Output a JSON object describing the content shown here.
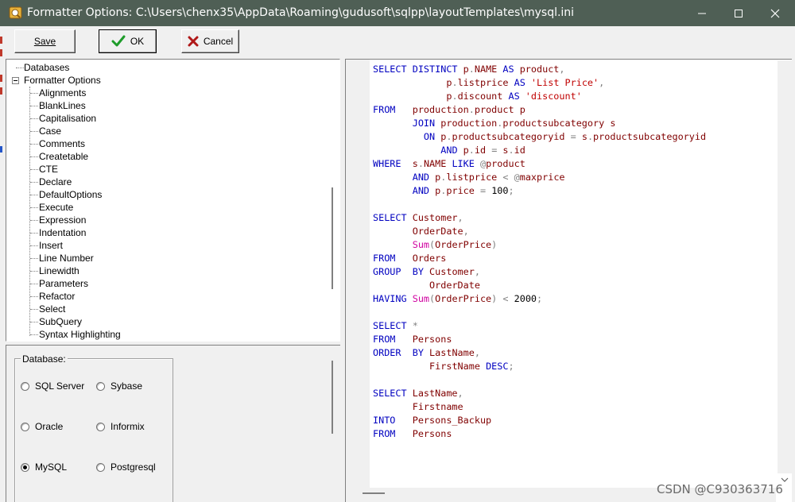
{
  "window": {
    "title": "Formatter Options: C:\\Users\\chenx35\\AppData\\Roaming\\gudusoft\\sqlpp\\layoutTemplates\\mysql.ini",
    "title_bar_color": "#4f5f55"
  },
  "toolbar": {
    "save_label": "Save",
    "ok_label": "OK",
    "cancel_label": "Cancel",
    "ok_icon": "green-check-icon",
    "cancel_icon": "red-x-icon"
  },
  "tree": {
    "root_items": [
      "Databases",
      "Formatter Options"
    ],
    "children": [
      "Alignments",
      "BlankLines",
      "Capitalisation",
      "Case",
      "Comments",
      "Createtable",
      "CTE",
      "Declare",
      "DefaultOptions",
      "Execute",
      "Expression",
      "Indentation",
      "Insert",
      "Line Number",
      "Linewidth",
      "Parameters",
      "Refactor",
      "Select",
      "SubQuery",
      "Syntax Highlighting"
    ]
  },
  "database_group": {
    "legend": "Database:",
    "options": [
      {
        "label": "SQL Server",
        "checked": false
      },
      {
        "label": "Sybase",
        "checked": false
      },
      {
        "label": "Oracle",
        "checked": false
      },
      {
        "label": "Informix",
        "checked": false
      },
      {
        "label": "MySQL",
        "checked": true
      },
      {
        "label": "Postgresql",
        "checked": false
      }
    ]
  },
  "colors": {
    "keyword": "#0000c0",
    "identifier": "#800000",
    "string": "#c00000",
    "function": "#d000a0"
  },
  "code_lines": [
    [
      [
        "kw",
        "SELECT "
      ],
      [
        "kw",
        "DISTINCT "
      ],
      [
        "id",
        "p"
      ],
      [
        "op",
        "."
      ],
      [
        "id",
        "NAME "
      ],
      [
        "kw",
        "AS "
      ],
      [
        "id",
        "product"
      ],
      [
        "op",
        ","
      ]
    ],
    [
      [
        "",
        "             "
      ],
      [
        "id",
        "p"
      ],
      [
        "op",
        "."
      ],
      [
        "id",
        "listprice "
      ],
      [
        "kw",
        "AS "
      ],
      [
        "str",
        "'List Price'"
      ],
      [
        "op",
        ","
      ]
    ],
    [
      [
        "",
        "             "
      ],
      [
        "id",
        "p"
      ],
      [
        "op",
        "."
      ],
      [
        "id",
        "discount "
      ],
      [
        "kw",
        "AS "
      ],
      [
        "str",
        "'discount'"
      ]
    ],
    [
      [
        "kw",
        "FROM   "
      ],
      [
        "id",
        "production"
      ],
      [
        "op",
        "."
      ],
      [
        "id",
        "product "
      ],
      [
        "id",
        "p"
      ]
    ],
    [
      [
        "",
        "       "
      ],
      [
        "kw",
        "JOIN "
      ],
      [
        "id",
        "production"
      ],
      [
        "op",
        "."
      ],
      [
        "id",
        "productsubcategory "
      ],
      [
        "id",
        "s"
      ]
    ],
    [
      [
        "",
        "         "
      ],
      [
        "kw",
        "ON "
      ],
      [
        "id",
        "p"
      ],
      [
        "op",
        "."
      ],
      [
        "id",
        "productsubcategoryid "
      ],
      [
        "op",
        "= "
      ],
      [
        "id",
        "s"
      ],
      [
        "op",
        "."
      ],
      [
        "id",
        "productsubcategoryid"
      ]
    ],
    [
      [
        "",
        "            "
      ],
      [
        "kw",
        "AND "
      ],
      [
        "id",
        "p"
      ],
      [
        "op",
        "."
      ],
      [
        "id",
        "id "
      ],
      [
        "op",
        "= "
      ],
      [
        "id",
        "s"
      ],
      [
        "op",
        "."
      ],
      [
        "id",
        "id"
      ]
    ],
    [
      [
        "kw",
        "WHERE  "
      ],
      [
        "id",
        "s"
      ],
      [
        "op",
        "."
      ],
      [
        "id",
        "NAME "
      ],
      [
        "kw",
        "LIKE "
      ],
      [
        "op",
        "@"
      ],
      [
        "var",
        "product"
      ]
    ],
    [
      [
        "",
        "       "
      ],
      [
        "kw",
        "AND "
      ],
      [
        "id",
        "p"
      ],
      [
        "op",
        "."
      ],
      [
        "id",
        "listprice "
      ],
      [
        "op",
        "< "
      ],
      [
        "op",
        "@"
      ],
      [
        "var",
        "maxprice"
      ]
    ],
    [
      [
        "",
        "       "
      ],
      [
        "kw",
        "AND "
      ],
      [
        "id",
        "p"
      ],
      [
        "op",
        "."
      ],
      [
        "id",
        "price "
      ],
      [
        "op",
        "= "
      ],
      [
        "num",
        "100"
      ],
      [
        "op",
        ";"
      ]
    ],
    [
      [
        "",
        ""
      ]
    ],
    [
      [
        "kw",
        "SELECT "
      ],
      [
        "id",
        "Customer"
      ],
      [
        "op",
        ","
      ]
    ],
    [
      [
        "",
        "       "
      ],
      [
        "id",
        "OrderDate"
      ],
      [
        "op",
        ","
      ]
    ],
    [
      [
        "",
        "       "
      ],
      [
        "fn",
        "Sum"
      ],
      [
        "op",
        "("
      ],
      [
        "id",
        "OrderPrice"
      ],
      [
        "op",
        ")"
      ]
    ],
    [
      [
        "kw",
        "FROM   "
      ],
      [
        "id",
        "Orders"
      ]
    ],
    [
      [
        "kw",
        "GROUP  "
      ],
      [
        "kw",
        "BY "
      ],
      [
        "id",
        "Customer"
      ],
      [
        "op",
        ","
      ]
    ],
    [
      [
        "",
        "          "
      ],
      [
        "id",
        "OrderDate"
      ]
    ],
    [
      [
        "kw",
        "HAVING "
      ],
      [
        "fn",
        "Sum"
      ],
      [
        "op",
        "("
      ],
      [
        "id",
        "OrderPrice"
      ],
      [
        "op",
        ") "
      ],
      [
        "op",
        "< "
      ],
      [
        "num",
        "2000"
      ],
      [
        "op",
        ";"
      ]
    ],
    [
      [
        "",
        ""
      ]
    ],
    [
      [
        "kw",
        "SELECT "
      ],
      [
        "op",
        "*"
      ]
    ],
    [
      [
        "kw",
        "FROM   "
      ],
      [
        "id",
        "Persons"
      ]
    ],
    [
      [
        "kw",
        "ORDER  "
      ],
      [
        "kw",
        "BY "
      ],
      [
        "id",
        "LastName"
      ],
      [
        "op",
        ","
      ]
    ],
    [
      [
        "",
        "          "
      ],
      [
        "id",
        "FirstName "
      ],
      [
        "kw",
        "DESC"
      ],
      [
        "op",
        ";"
      ]
    ],
    [
      [
        "",
        ""
      ]
    ],
    [
      [
        "kw",
        "SELECT "
      ],
      [
        "id",
        "LastName"
      ],
      [
        "op",
        ","
      ]
    ],
    [
      [
        "",
        "       "
      ],
      [
        "id",
        "Firstname"
      ]
    ],
    [
      [
        "kw",
        "INTO   "
      ],
      [
        "id",
        "Persons_Backup"
      ]
    ],
    [
      [
        "kw",
        "FROM   "
      ],
      [
        "id",
        "Persons"
      ]
    ]
  ],
  "watermark": "CSDN @C930363716"
}
